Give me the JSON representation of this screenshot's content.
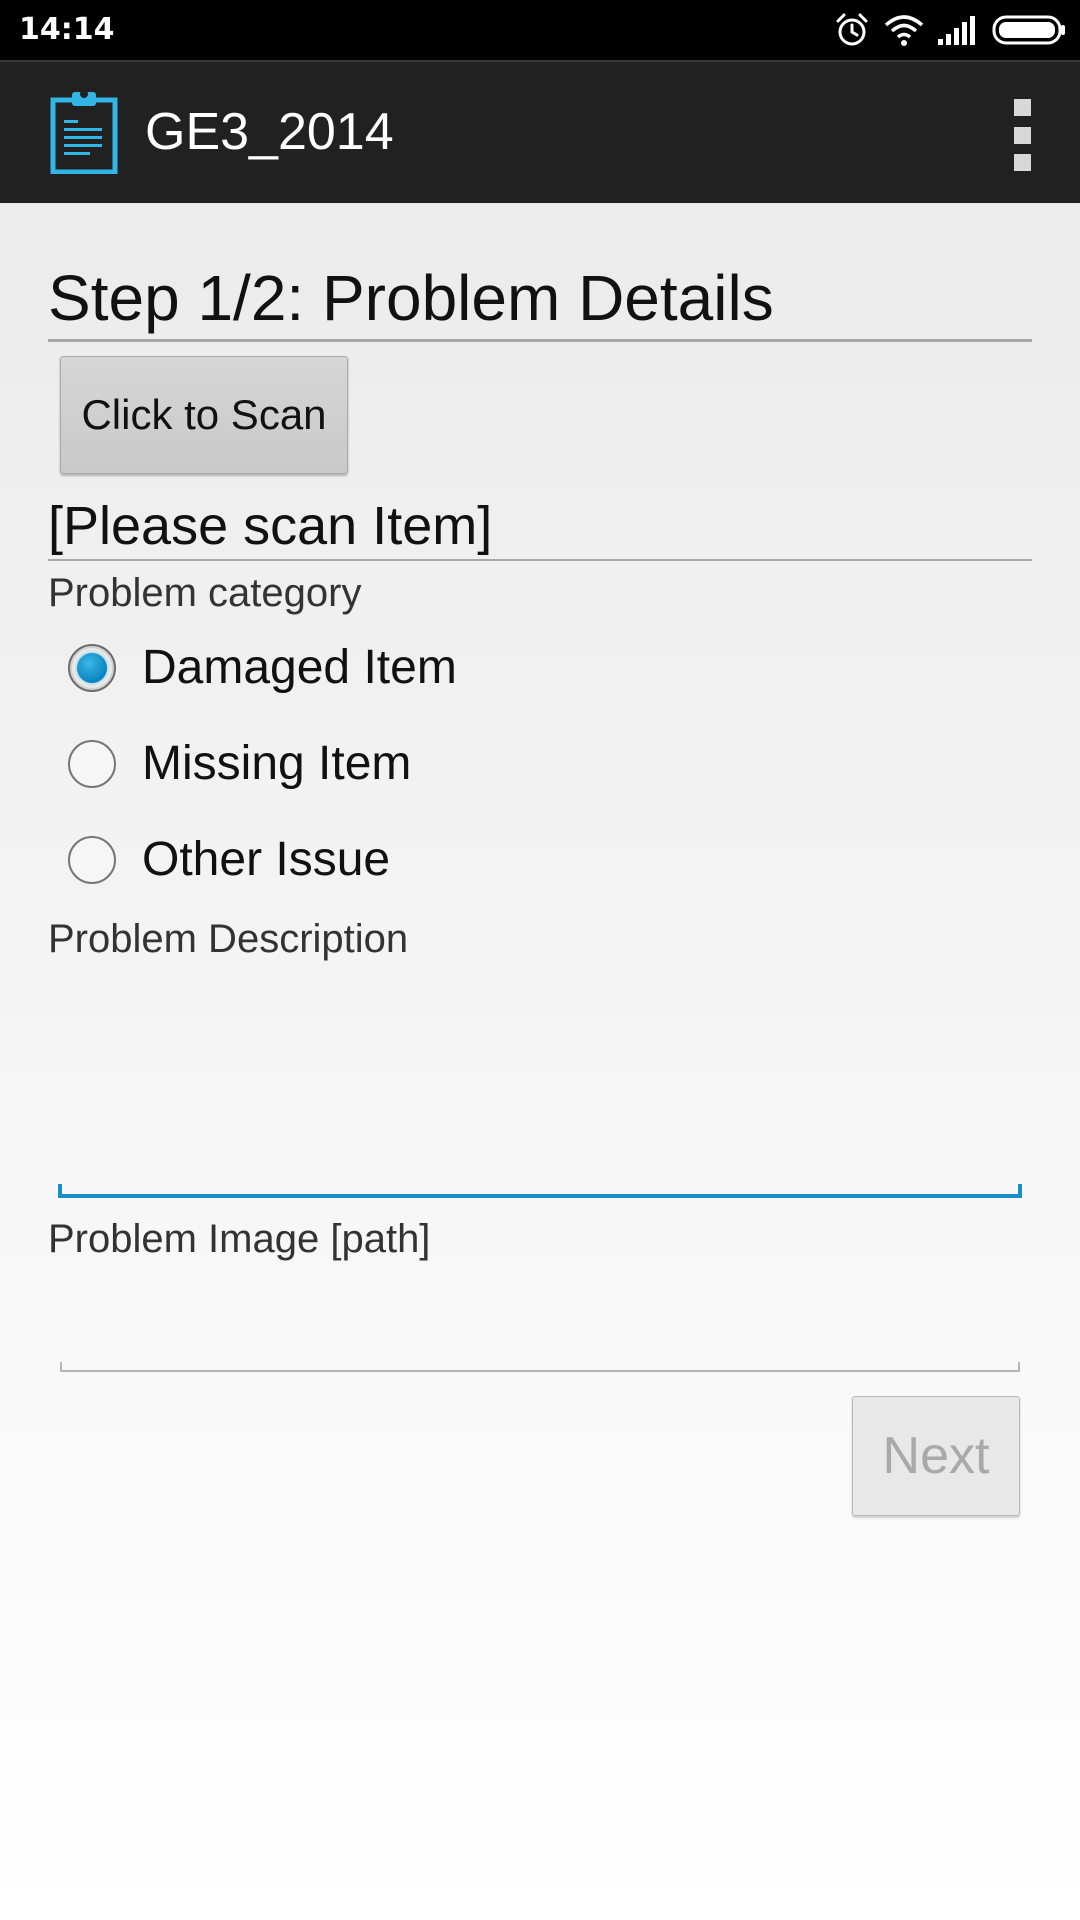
{
  "status_bar": {
    "time": "14:14",
    "icons": [
      "alarm-icon",
      "wifi-icon",
      "signal-icon",
      "battery-icon"
    ]
  },
  "action_bar": {
    "app_icon": "clipboard-icon",
    "title": "GE3_2014",
    "overflow_icon": "overflow-menu-icon"
  },
  "form": {
    "step_title": "Step 1/2: Problem Details",
    "scan_button_label": "Click to Scan",
    "scan_status": "[Please scan Item]",
    "category_label": "Problem category",
    "categories": [
      {
        "label": "Damaged Item",
        "checked": true
      },
      {
        "label": "Missing Item",
        "checked": false
      },
      {
        "label": "Other Issue",
        "checked": false
      }
    ],
    "description_label": "Problem Description",
    "description_value": "",
    "image_label": "Problem Image [path]",
    "image_value": "",
    "next_button_label": "Next"
  },
  "colors": {
    "accent": "#1a8ecb",
    "action_bar": "#212121",
    "status_bar": "#000000",
    "disabled_text": "#a9a9a9"
  }
}
